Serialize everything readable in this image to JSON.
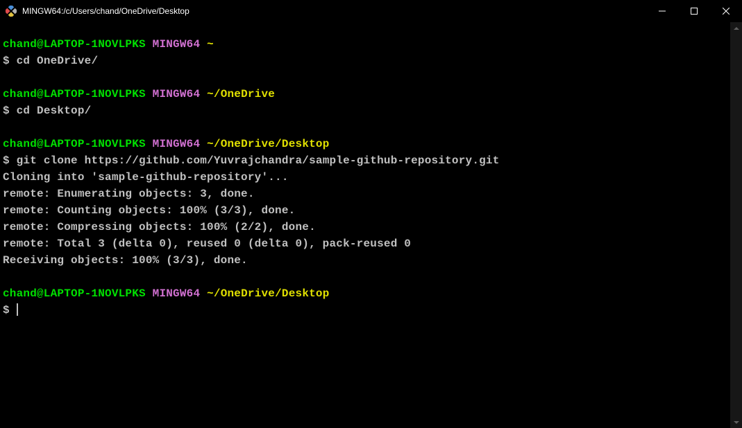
{
  "window": {
    "title": "MINGW64:/c/Users/chand/OneDrive/Desktop"
  },
  "session": {
    "user_host": "chand@LAPTOP-1NOVLPKS",
    "shell": "MINGW64"
  },
  "blocks": [
    {
      "path": "~",
      "command": "cd OneDrive/",
      "output": []
    },
    {
      "path": "~/OneDrive",
      "command": "cd Desktop/",
      "output": []
    },
    {
      "path": "~/OneDrive/Desktop",
      "command": "git clone https://github.com/Yuvrajchandra/sample-github-repository.git",
      "output": [
        "Cloning into 'sample-github-repository'...",
        "remote: Enumerating objects: 3, done.",
        "remote: Counting objects: 100% (3/3), done.",
        "remote: Compressing objects: 100% (2/2), done.",
        "remote: Total 3 (delta 0), reused 0 (delta 0), pack-reused 0",
        "Receiving objects: 100% (3/3), done."
      ]
    },
    {
      "path": "~/OneDrive/Desktop",
      "command": "",
      "output": [],
      "active": true
    }
  ]
}
